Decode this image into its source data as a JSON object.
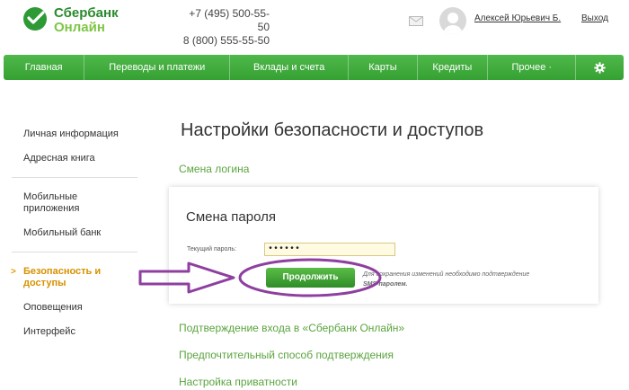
{
  "header": {
    "logo_line1": "Сбербанк",
    "logo_line2": "Онлайн",
    "phone1": "+7 (495) 500-55-50",
    "phone2": "8 (800) 555-55-50",
    "user_name": "Алексей Юрьевич Б.",
    "logout_label": "Выход"
  },
  "nav": {
    "items": [
      {
        "label": "Главная"
      },
      {
        "label": "Переводы и платежи"
      },
      {
        "label": "Вклады и счета"
      },
      {
        "label": "Карты"
      },
      {
        "label": "Кредиты"
      },
      {
        "label": "Прочее ·"
      }
    ],
    "accent": "#3fa93a"
  },
  "sidebar": {
    "items": [
      {
        "label": "Личная информация"
      },
      {
        "label": "Адресная книга"
      },
      {
        "label": "Мобильные приложения"
      },
      {
        "label": "Мобильный банк"
      },
      {
        "label": "Безопасность и доступы"
      },
      {
        "label": "Оповещения"
      },
      {
        "label": "Интерфейс"
      }
    ],
    "active_color": "#d79100"
  },
  "main": {
    "title": "Настройки безопасности и доступов",
    "change_login_link": "Смена логина",
    "card": {
      "title": "Смена пароля",
      "field_label": "Текущий пароль:",
      "field_value": "••••••",
      "button_label": "Продолжить",
      "note_prefix": "Для сохранения изменений необходимо подтверждение ",
      "note_bold": "SMS-паролем."
    },
    "links": [
      {
        "label": "Подтверждение входа в «Сбербанк Онлайн»"
      },
      {
        "label": "Предпочтительный способ подтверждения"
      },
      {
        "label": "Настройка приватности"
      }
    ]
  },
  "annotation_color": "#8e3fa0"
}
